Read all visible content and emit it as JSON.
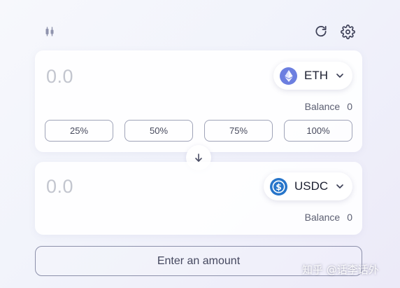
{
  "toolbar": {
    "chart_icon": "candlestick-chart-icon",
    "refresh_icon": "refresh-icon",
    "settings_icon": "gear-icon"
  },
  "from": {
    "amount_placeholder": "0.0",
    "token": {
      "symbol": "ETH",
      "icon": "ethereum-logo-icon",
      "color": "#6C7FE0"
    },
    "balance_label": "Balance",
    "balance_value": "0",
    "percent_buttons": [
      "25%",
      "50%",
      "75%",
      "100%"
    ]
  },
  "switch_icon": "arrow-down-icon",
  "to": {
    "amount_placeholder": "0.0",
    "token": {
      "symbol": "USDC",
      "icon": "usdc-logo-icon",
      "color": "#2775CA"
    },
    "balance_label": "Balance",
    "balance_value": "0"
  },
  "submit": {
    "label": "Enter an amount"
  },
  "watermark": "知乎 @话李话外"
}
